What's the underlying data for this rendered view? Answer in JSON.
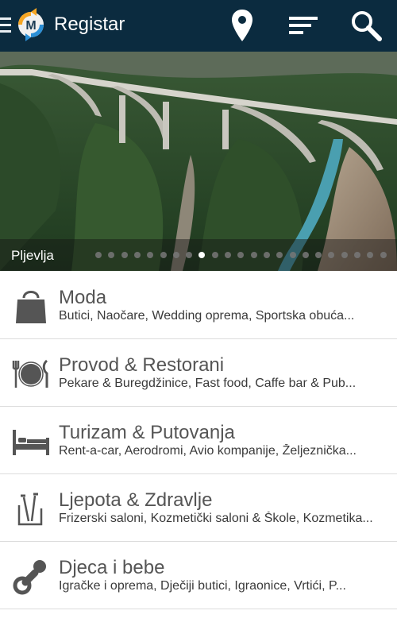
{
  "appbar": {
    "title": "Registar",
    "icons": [
      "menu-icon",
      "logo",
      "location-pin-icon",
      "filter-icon",
      "search-icon"
    ]
  },
  "hero": {
    "caption": "Pljevlja",
    "slides_total": 23,
    "active_slide": 8
  },
  "categories": [
    {
      "title": "Moda",
      "subtitle": "Butici, Naočare, Wedding oprema, Sportska obuća...",
      "icon": "shopping-bag-icon"
    },
    {
      "title": "Provod & Restorani",
      "subtitle": "Pekare & Buregdžinice, Fast food, Caffe bar & Pub...",
      "icon": "plate-cutlery-icon"
    },
    {
      "title": "Turizam & Putovanja",
      "subtitle": "Rent-a-car, Aerodromi, Avio kompanije, Željeznička...",
      "icon": "bed-icon"
    },
    {
      "title": "Ljepota & Zdravlje",
      "subtitle": "Frizerski saloni, Kozmetički saloni & Škole, Kozmetika...",
      "icon": "toothbrush-icon"
    },
    {
      "title": "Djeca i bebe",
      "subtitle": "Igračke i oprema, Dječiji butici, Igraonice, Vrtići, P...",
      "icon": "pacifier-icon"
    }
  ],
  "colors": {
    "appbar": "#0b2b3f",
    "title_text": "#555555",
    "divider": "#dcdcdc"
  }
}
